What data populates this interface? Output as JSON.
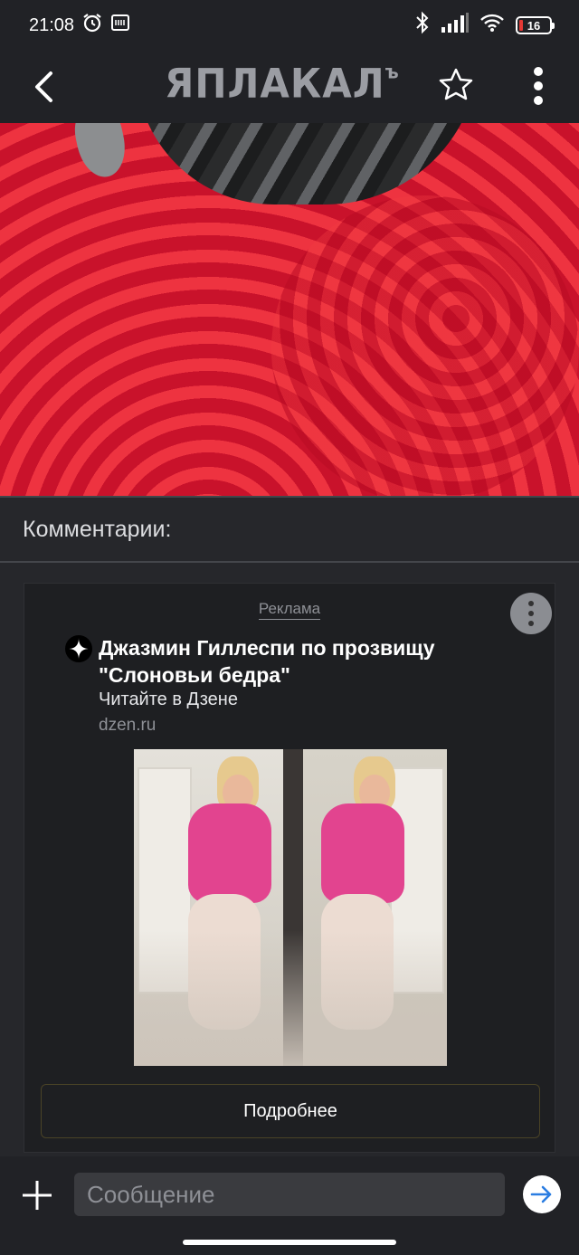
{
  "status_bar": {
    "time": "21:08",
    "battery": "16",
    "icons": [
      "alarm-icon",
      "screen-record-icon",
      "bluetooth-icon",
      "signal-icon",
      "wifi-icon",
      "battery-icon"
    ]
  },
  "app_bar": {
    "logo_text": "ЯПЛАКАЛ",
    "logo_suffix": "ъ",
    "icons": [
      "back-arrow-icon",
      "star-icon",
      "more-vertical-icon"
    ]
  },
  "comments": {
    "header": "Комментарии:"
  },
  "ad": {
    "label": "Реклама",
    "title": "Джазмин Гиллеспи по прозвищу \"Слоновьи бедра\"",
    "subtitle": "Читайте в Дзене",
    "domain": "dzen.ru",
    "button_label": "Подробнее"
  },
  "composer": {
    "placeholder": "Сообщение",
    "icons": [
      "plus-icon",
      "send-arrow-icon"
    ]
  },
  "colors": {
    "background": "#26272b",
    "bar": "#212226",
    "card": "#1e1f22",
    "accent_border": "#4a4326",
    "muted_text": "#8e9096"
  }
}
